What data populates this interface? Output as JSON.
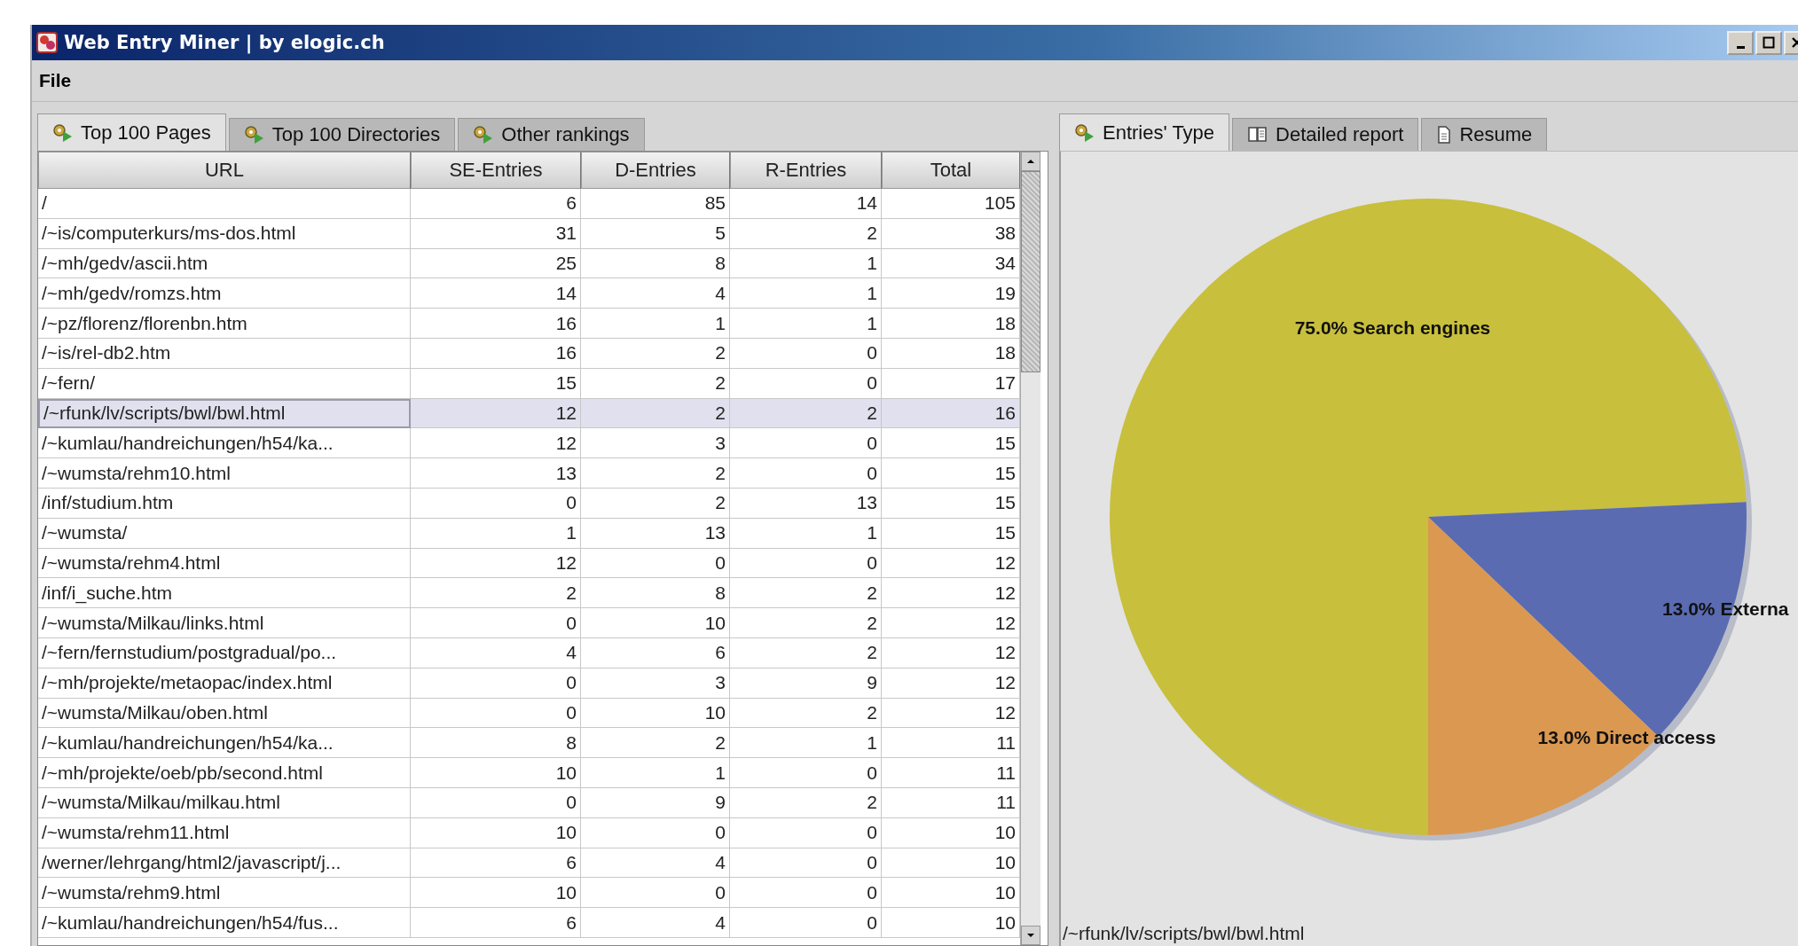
{
  "window": {
    "title": "Web Entry Miner | by elogic.ch"
  },
  "menu": [
    "File"
  ],
  "left_tabs": [
    {
      "label": "Top 100 Pages",
      "selected": true
    },
    {
      "label": "Top 100 Directories",
      "selected": false
    },
    {
      "label": "Other rankings",
      "selected": false
    }
  ],
  "table": {
    "columns": [
      "URL",
      "SE-Entries",
      "D-Entries",
      "R-Entries",
      "Total"
    ],
    "rows": [
      {
        "cells": [
          "/",
          "6",
          "85",
          "14",
          "105"
        ],
        "selected": false
      },
      {
        "cells": [
          "/~is/computerkurs/ms-dos.html",
          "31",
          "5",
          "2",
          "38"
        ],
        "selected": false
      },
      {
        "cells": [
          "/~mh/gedv/ascii.htm",
          "25",
          "8",
          "1",
          "34"
        ],
        "selected": false
      },
      {
        "cells": [
          "/~mh/gedv/romzs.htm",
          "14",
          "4",
          "1",
          "19"
        ],
        "selected": false
      },
      {
        "cells": [
          "/~pz/florenz/florenbn.htm",
          "16",
          "1",
          "1",
          "18"
        ],
        "selected": false
      },
      {
        "cells": [
          "/~is/rel-db2.htm",
          "16",
          "2",
          "0",
          "18"
        ],
        "selected": false
      },
      {
        "cells": [
          "/~fern/",
          "15",
          "2",
          "0",
          "17"
        ],
        "selected": false
      },
      {
        "cells": [
          "/~rfunk/lv/scripts/bwl/bwl.html",
          "12",
          "2",
          "2",
          "16"
        ],
        "selected": true
      },
      {
        "cells": [
          "/~kumlau/handreichungen/h54/ka...",
          "12",
          "3",
          "0",
          "15"
        ],
        "selected": false
      },
      {
        "cells": [
          "/~wumsta/rehm10.html",
          "13",
          "2",
          "0",
          "15"
        ],
        "selected": false
      },
      {
        "cells": [
          "/inf/studium.htm",
          "0",
          "2",
          "13",
          "15"
        ],
        "selected": false
      },
      {
        "cells": [
          "/~wumsta/",
          "1",
          "13",
          "1",
          "15"
        ],
        "selected": false
      },
      {
        "cells": [
          "/~wumsta/rehm4.html",
          "12",
          "0",
          "0",
          "12"
        ],
        "selected": false
      },
      {
        "cells": [
          "/inf/i_suche.htm",
          "2",
          "8",
          "2",
          "12"
        ],
        "selected": false
      },
      {
        "cells": [
          "/~wumsta/Milkau/links.html",
          "0",
          "10",
          "2",
          "12"
        ],
        "selected": false
      },
      {
        "cells": [
          "/~fern/fernstudium/postgradual/po...",
          "4",
          "6",
          "2",
          "12"
        ],
        "selected": false
      },
      {
        "cells": [
          "/~mh/projekte/metaopac/index.html",
          "0",
          "3",
          "9",
          "12"
        ],
        "selected": false
      },
      {
        "cells": [
          "/~wumsta/Milkau/oben.html",
          "0",
          "10",
          "2",
          "12"
        ],
        "selected": false
      },
      {
        "cells": [
          "/~kumlau/handreichungen/h54/ka...",
          "8",
          "2",
          "1",
          "11"
        ],
        "selected": false
      },
      {
        "cells": [
          "/~mh/projekte/oeb/pb/second.html",
          "10",
          "1",
          "0",
          "11"
        ],
        "selected": false
      },
      {
        "cells": [
          "/~wumsta/Milkau/milkau.html",
          "0",
          "9",
          "2",
          "11"
        ],
        "selected": false
      },
      {
        "cells": [
          "/~wumsta/rehm11.html",
          "10",
          "0",
          "0",
          "10"
        ],
        "selected": false
      },
      {
        "cells": [
          "/werner/lehrgang/html2/javascript/j...",
          "6",
          "4",
          "0",
          "10"
        ],
        "selected": false
      },
      {
        "cells": [
          "/~wumsta/rehm9.html",
          "10",
          "0",
          "0",
          "10"
        ],
        "selected": false
      },
      {
        "cells": [
          "/~kumlau/handreichungen/h54/fus...",
          "6",
          "4",
          "0",
          "10"
        ],
        "selected": false
      }
    ]
  },
  "right_tabs": [
    {
      "label": "Entries' Type",
      "selected": true,
      "kind": "gear"
    },
    {
      "label": "Detailed report",
      "selected": false,
      "kind": "book"
    },
    {
      "label": "Resume",
      "selected": false,
      "kind": "document"
    }
  ],
  "entries_chart": {
    "chart_data": {
      "type": "pie",
      "values": [
        75,
        13,
        13
      ],
      "colors": [
        "#c8bf3c",
        "#5a6bb2",
        "#db9851"
      ],
      "value_labels": [
        "75.0% Search engines",
        "13.0% Externa",
        "13.0% Direct access"
      ]
    }
  },
  "status_bar": "/~rfunk/lv/scripts/bwl/bwl.html"
}
